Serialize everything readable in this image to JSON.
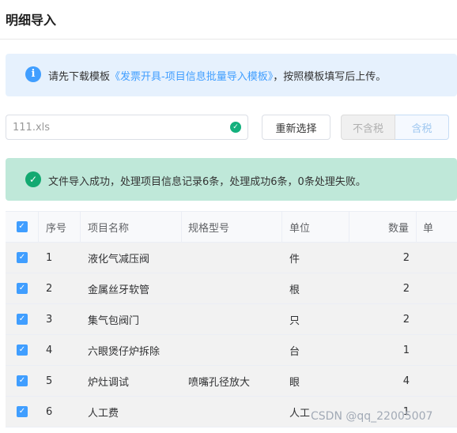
{
  "page": {
    "title": "明细导入"
  },
  "info_alert": {
    "prefix": "请先下载模板",
    "link": "《发票开具-项目信息批量导入模板》",
    "suffix": "，按照模板填写后上传。",
    "icon": "info-icon"
  },
  "upload": {
    "file_name": "111.xls",
    "reselect_label": "重新选择",
    "tax_excluded_label": "不含税",
    "tax_included_label": "含税"
  },
  "success_alert": {
    "text": "文件导入成功，处理项目信息记录6条，处理成功6条，0条处理失败。",
    "icon": "check-circle-icon"
  },
  "table": {
    "columns": [
      "序号",
      "项目名称",
      "规格型号",
      "单位",
      "数量",
      "单"
    ],
    "rows": [
      {
        "seq": "1",
        "name": "液化气减压阀",
        "spec": "",
        "unit": "件",
        "qty": "2"
      },
      {
        "seq": "2",
        "name": "金属丝牙软管",
        "spec": "",
        "unit": "根",
        "qty": "2"
      },
      {
        "seq": "3",
        "name": "集气包阀门",
        "spec": "",
        "unit": "只",
        "qty": "2"
      },
      {
        "seq": "4",
        "name": "六眼煲仔炉拆除",
        "spec": "",
        "unit": "台",
        "qty": "1"
      },
      {
        "seq": "5",
        "name": "炉灶调试",
        "spec": "喷嘴孔径放大",
        "unit": "眼",
        "qty": "4"
      },
      {
        "seq": "6",
        "name": "人工费",
        "spec": "",
        "unit": "人工",
        "qty": "1"
      }
    ]
  },
  "watermark": "CSDN @qq_22005007",
  "colors": {
    "accent": "#409eff",
    "success": "#13a971"
  }
}
